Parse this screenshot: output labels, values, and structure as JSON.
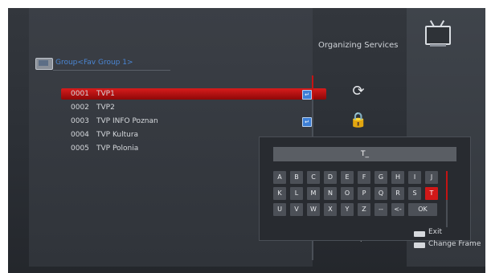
{
  "header": {
    "group_label": "Group<Fav Group 1>"
  },
  "page_title": "Organizing Services",
  "channels": [
    {
      "num": "0001",
      "name": "TVP1",
      "selected": true,
      "mark": true
    },
    {
      "num": "0002",
      "name": "TVP2",
      "selected": false,
      "mark": false
    },
    {
      "num": "0003",
      "name": "TVP INFO Poznan",
      "selected": false,
      "mark": true
    },
    {
      "num": "0004",
      "name": "TVP Kultura",
      "selected": false,
      "mark": false
    },
    {
      "num": "0005",
      "name": "TVP Polonia",
      "selected": false,
      "mark": false
    }
  ],
  "keyboard": {
    "input": "T_",
    "rows": [
      [
        "A",
        "B",
        "C",
        "D",
        "E",
        "F",
        "G",
        "H",
        "I",
        "J"
      ],
      [
        "K",
        "L",
        "M",
        "N",
        "O",
        "P",
        "Q",
        "R",
        "S",
        "T"
      ],
      [
        "U",
        "V",
        "W",
        "X",
        "Y",
        "Z",
        "--",
        "<-",
        "OK"
      ]
    ],
    "highlighted_key": "T"
  },
  "hints": {
    "exit": "Exit",
    "change_frame": "Change Frame"
  },
  "colors": {
    "accent": "#d01818",
    "group_label": "#4a86d4"
  },
  "icons": [
    "tv-icon",
    "move-icon",
    "lock-icon",
    "swap-icon"
  ]
}
